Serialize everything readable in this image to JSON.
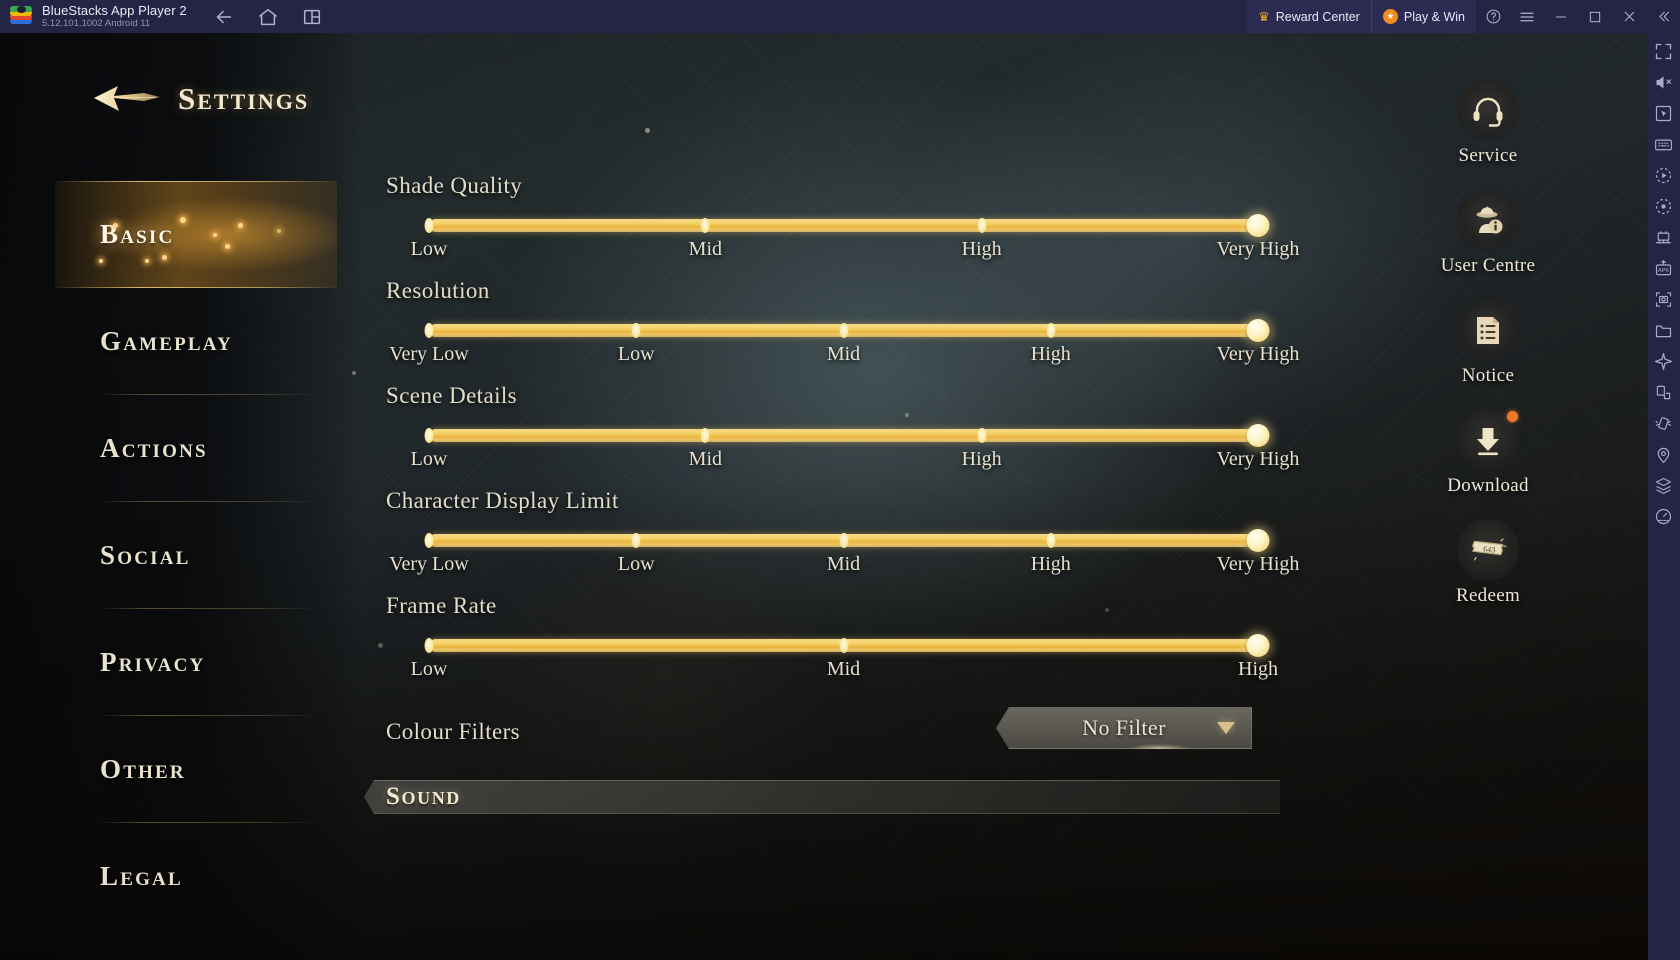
{
  "window": {
    "app_title": "BlueStacks App Player 2",
    "version_line": "5.12.101.1002  Android 11",
    "nav": [
      {
        "name": "back-icon",
        "label": "Back"
      },
      {
        "name": "home-icon",
        "label": "Home"
      },
      {
        "name": "multi-instance-icon",
        "label": "Instances"
      }
    ],
    "reward_center": "Reward Center",
    "play_and_win": "Play & Win",
    "controls": [
      {
        "name": "help-button",
        "label": "?"
      },
      {
        "name": "menu-button",
        "label": "☰"
      },
      {
        "name": "minimize-button",
        "label": "—"
      },
      {
        "name": "maximize-button",
        "label": "□"
      },
      {
        "name": "close-button",
        "label": "✕"
      },
      {
        "name": "collapse-sidebar-button",
        "label": "«"
      }
    ],
    "tools": [
      "fullscreen-icon",
      "mute-icon",
      "pointer-icon",
      "keyboard-icon",
      "macro-play-icon",
      "macro-record-icon",
      "multi-instance-manager-icon",
      "install-apk-icon",
      "screenshot-icon",
      "media-manager-icon",
      "airplane-mode-icon",
      "rotate-icon",
      "shake-icon",
      "location-icon",
      "layers-icon",
      "performance-icon"
    ]
  },
  "header": {
    "title": "Settings",
    "back_arrow_icon": "arrow-left-ornament-icon"
  },
  "sidebar": {
    "items": [
      {
        "label": "Basic",
        "active": true
      },
      {
        "label": "Gameplay",
        "active": false
      },
      {
        "label": "Actions",
        "active": false
      },
      {
        "label": "Social",
        "active": false
      },
      {
        "label": "Privacy",
        "active": false
      },
      {
        "label": "Other",
        "active": false
      },
      {
        "label": "Legal",
        "active": false
      }
    ]
  },
  "settings": {
    "sliders": [
      {
        "label": "Shade Quality",
        "ticks": [
          "Low",
          "Mid",
          "High",
          "Very High"
        ],
        "value_index": 3,
        "value_label": "Very High"
      },
      {
        "label": "Resolution",
        "ticks": [
          "Very Low",
          "Low",
          "Mid",
          "High",
          "Very High"
        ],
        "value_index": 4,
        "value_label": "Very High"
      },
      {
        "label": "Scene Details",
        "ticks": [
          "Low",
          "Mid",
          "High",
          "Very High"
        ],
        "value_index": 3,
        "value_label": "Very High"
      },
      {
        "label": "Character Display Limit",
        "ticks": [
          "Very Low",
          "Low",
          "Mid",
          "High",
          "Very High"
        ],
        "value_index": 4,
        "value_label": "Very High"
      },
      {
        "label": "Frame Rate",
        "ticks": [
          "Low",
          "Mid",
          "High"
        ],
        "value_index": 2,
        "value_label": "High"
      }
    ],
    "colour_filters": {
      "label": "Colour Filters",
      "selected": "No Filter",
      "caret_icon": "chevron-down-icon"
    },
    "sound_section": {
      "label": "Sound"
    }
  },
  "game_rail": [
    {
      "label": "Service",
      "icon": "headset-icon",
      "badge": false
    },
    {
      "label": "User Centre",
      "icon": "user-info-icon",
      "badge": false
    },
    {
      "label": "Notice",
      "icon": "document-list-icon",
      "badge": false
    },
    {
      "label": "Download",
      "icon": "download-arrow-icon",
      "badge": true
    },
    {
      "label": "Redeem",
      "icon": "ticket-icon",
      "badge": false
    }
  ],
  "colors": {
    "titlebar": "#242444",
    "accent_gold": "#f3d47a",
    "track_gold": "#f4cf62",
    "badge_orange": "#f0782a",
    "text_cream": "#e9e2cd"
  }
}
